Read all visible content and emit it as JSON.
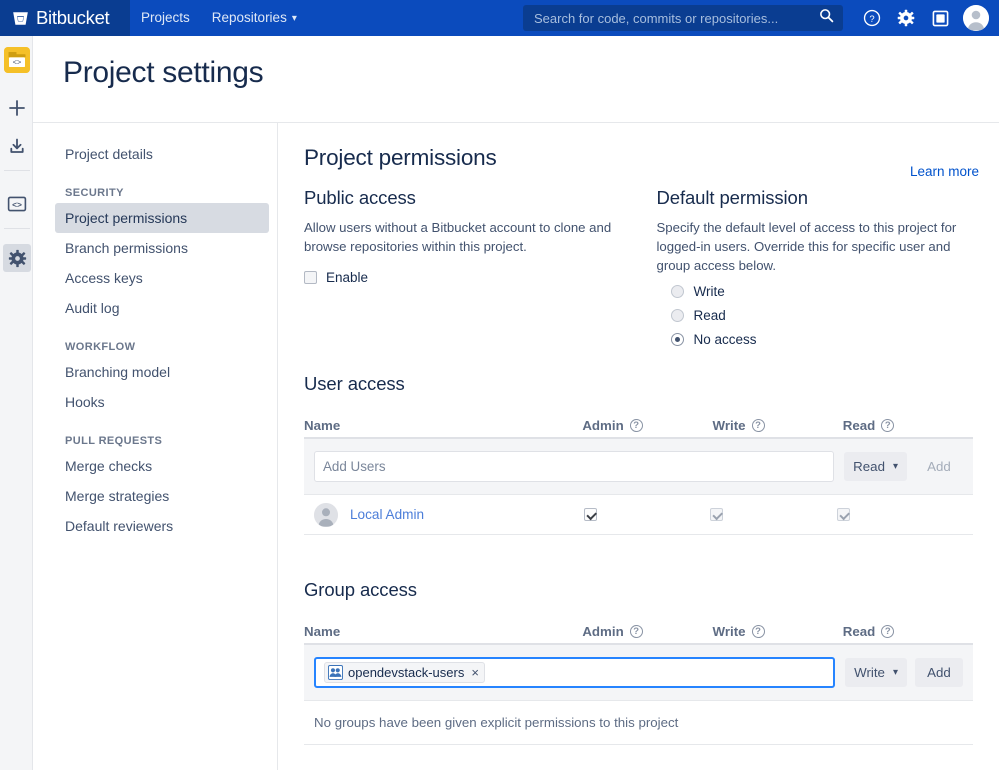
{
  "topnav": {
    "brand": "Bitbucket",
    "brand_icon": "bitbucket-logo-icon",
    "links": [
      {
        "label": "Projects",
        "caret": false
      },
      {
        "label": "Repositories",
        "caret": true
      }
    ],
    "caret_glyph": "▾",
    "search": {
      "placeholder": "Search for code, commits or repositories...",
      "value": "",
      "icon": "search-icon"
    },
    "icons": [
      {
        "name": "help-icon",
        "glyph": "?"
      },
      {
        "name": "settings-gear-icon",
        "glyph": "⚙"
      },
      {
        "name": "app-switcher-icon",
        "glyph": "□"
      }
    ],
    "avatar": "user-avatar"
  },
  "rail": {
    "project_avatar": "project-folder-code-icon",
    "buttons": [
      {
        "name": "create-icon",
        "glyph": "+",
        "active": false
      },
      {
        "name": "clone-download-icon",
        "glyph": "⤓",
        "active": false
      },
      {
        "name": "code-brackets-icon",
        "glyph": "<>",
        "active": false
      },
      {
        "name": "project-settings-gear-icon",
        "glyph": "⚙",
        "active": true
      }
    ]
  },
  "header": {
    "title": "Project settings"
  },
  "sidebar": {
    "items": [
      {
        "label": "Project details",
        "active": false,
        "type": "item"
      },
      {
        "label": "SECURITY",
        "type": "heading"
      },
      {
        "label": "Project permissions",
        "active": true,
        "type": "item"
      },
      {
        "label": "Branch permissions",
        "active": false,
        "type": "item"
      },
      {
        "label": "Access keys",
        "active": false,
        "type": "item"
      },
      {
        "label": "Audit log",
        "active": false,
        "type": "item"
      },
      {
        "label": "WORKFLOW",
        "type": "heading"
      },
      {
        "label": "Branching model",
        "active": false,
        "type": "item"
      },
      {
        "label": "Hooks",
        "active": false,
        "type": "item"
      },
      {
        "label": "PULL REQUESTS",
        "type": "heading"
      },
      {
        "label": "Merge checks",
        "active": false,
        "type": "item"
      },
      {
        "label": "Merge strategies",
        "active": false,
        "type": "item"
      },
      {
        "label": "Default reviewers",
        "active": false,
        "type": "item"
      }
    ]
  },
  "main": {
    "page_heading": "Project permissions",
    "learn_more": "Learn more",
    "public_access": {
      "heading": "Public access",
      "description": "Allow users without a Bitbucket account to clone and browse repositories within this project.",
      "checkbox_label": "Enable",
      "checked": false
    },
    "default_permission": {
      "heading": "Default permission",
      "description": "Specify the default level of access to this project for logged-in users. Override this for specific user and group access below.",
      "options": [
        {
          "label": "Write",
          "checked": false
        },
        {
          "label": "Read",
          "checked": false
        },
        {
          "label": "No access",
          "checked": true
        }
      ]
    },
    "user_access": {
      "heading": "User access",
      "columns": [
        "Name",
        "Admin",
        "Write",
        "Read"
      ],
      "help_glyph": "?",
      "add_input_placeholder": "Add Users",
      "add_input_value": "",
      "permission_dropdown": "Read",
      "add_button": "Add",
      "add_button_enabled": false,
      "rows": [
        {
          "name": "Local Admin",
          "avatar": "user-avatar",
          "admin": {
            "checked": true,
            "disabled": false
          },
          "write": {
            "checked": true,
            "disabled": true
          },
          "read": {
            "checked": true,
            "disabled": true
          }
        }
      ]
    },
    "group_access": {
      "heading": "Group access",
      "columns": [
        "Name",
        "Admin",
        "Write",
        "Read"
      ],
      "help_glyph": "?",
      "chip": {
        "label": "opendevstack-users",
        "icon": "group-people-icon",
        "remove_glyph": "×"
      },
      "permission_dropdown": "Write",
      "add_button": "Add",
      "add_button_enabled": true,
      "empty_message": "No groups have been given explicit permissions to this project"
    }
  },
  "colors": {
    "nav_blue": "#0b4bbd",
    "nav_blue_dark": "#0a3d91",
    "link_blue": "#0052cc",
    "heading_navy": "#172b4d",
    "project_yellow": "#f5c028",
    "row_grey": "#f4f5f7"
  }
}
